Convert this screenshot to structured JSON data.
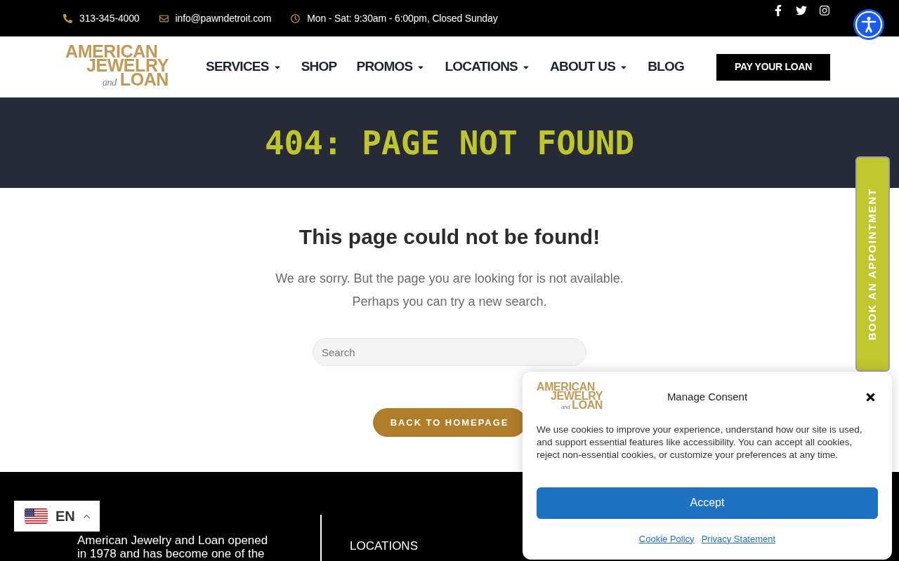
{
  "top_bar": {
    "contacts": [
      {
        "kind": "phone",
        "text": "313-345-4000"
      },
      {
        "kind": "email",
        "text": "info@pawndetroit.com"
      },
      {
        "kind": "hours",
        "text": "Mon - Sat: 9:30am - 6:00pm, Closed Sunday"
      }
    ],
    "social": [
      {
        "kind": "facebook"
      },
      {
        "kind": "twitter"
      },
      {
        "kind": "instagram"
      }
    ]
  },
  "header": {
    "logo": {
      "line_1": "AMERICAN",
      "line_2": "JEWELRY",
      "connector": "and",
      "line_3": "LOAN"
    },
    "nav": [
      {
        "label": "SERVICES",
        "dropdown": true
      },
      {
        "label": "SHOP",
        "dropdown": false
      },
      {
        "label": "PROMOS",
        "dropdown": true
      },
      {
        "label": "LOCATIONS",
        "dropdown": true
      },
      {
        "label": "ABOUT US",
        "dropdown": true
      },
      {
        "label": "BLOG",
        "dropdown": false
      }
    ],
    "cta": "PAY YOUR LOAN"
  },
  "banner": {
    "title": "404: PAGE NOT FOUND"
  },
  "content": {
    "heading": "This page could not be found!",
    "lines": [
      "We are sorry. But the page you are looking for is not available.",
      "Perhaps you can try a new search."
    ],
    "search": {
      "placeholder": "Search"
    },
    "button": "BACK TO HOMEPAGE"
  },
  "footer": {
    "about_lines": [
      "American Jewelry and Loan opened",
      "in 1978 and has become one of the"
    ],
    "column_heading": "LOCATIONS"
  },
  "language_switcher": {
    "code": "EN"
  },
  "appointment_tab": {
    "label": "BOOK AN APPOINTMENT"
  },
  "consent_dialog": {
    "logo": {
      "line_1": "AMERICAN",
      "line_2": "JEWELRY",
      "connector": "and",
      "line_3": "LOAN"
    },
    "title": "Manage Consent",
    "text": "We use cookies to improve your experience, understand how our site is used, and support essential features like accessibility. You can accept all cookies, reject non-essential cookies, or customize your preferences at any time.",
    "accept": "Accept",
    "links": [
      "Cookie Policy",
      "Privacy Statement"
    ]
  }
}
